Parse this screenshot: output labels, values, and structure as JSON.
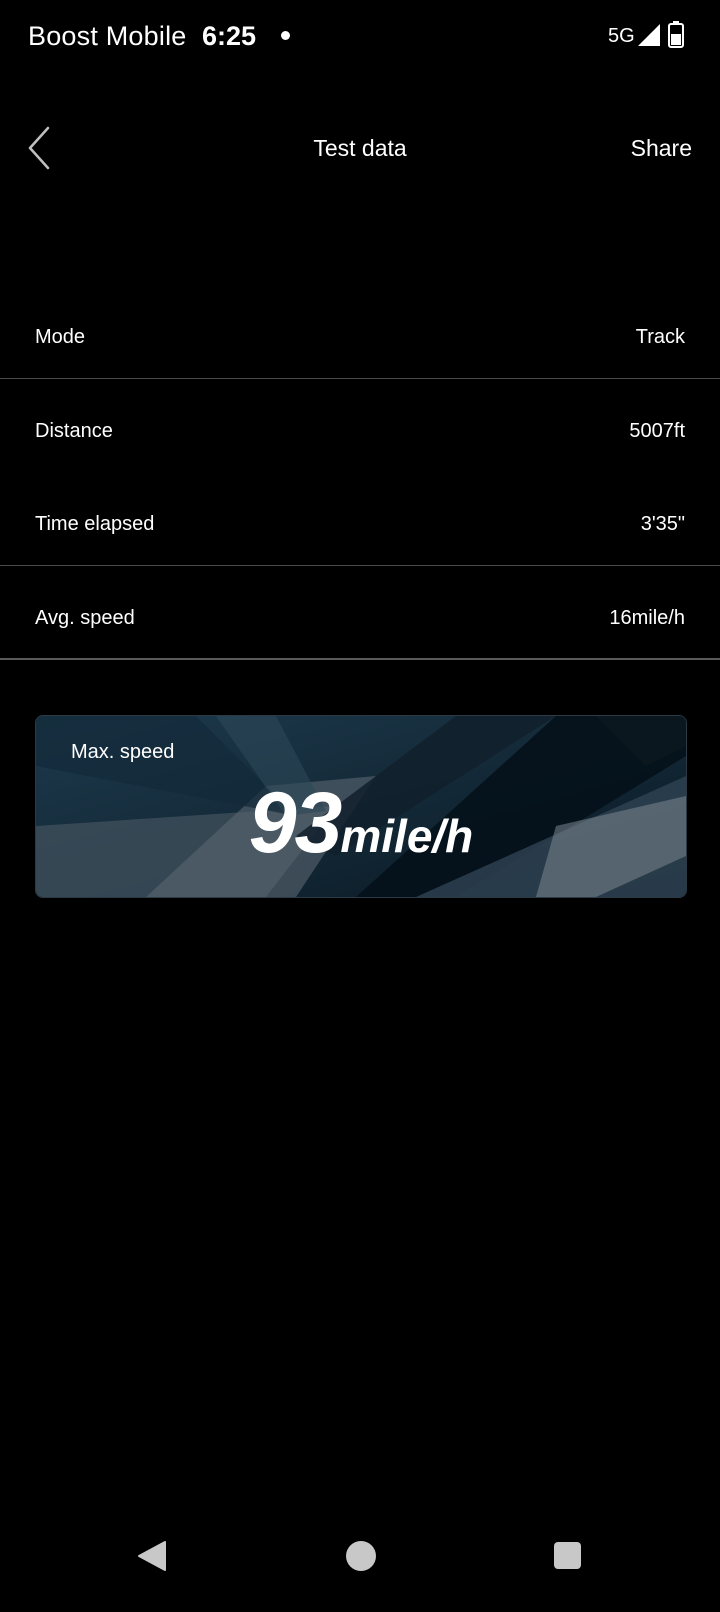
{
  "status_bar": {
    "carrier": "Boost Mobile",
    "time": "6:25",
    "network": "5G"
  },
  "header": {
    "title": "Test data",
    "share_label": "Share",
    "back_icon": "chevron-left-icon"
  },
  "rows": [
    {
      "label": "Mode",
      "value": "Track"
    },
    {
      "label": "Distance",
      "value": "5007ft"
    },
    {
      "label": "Time elapsed",
      "value": "3'35\""
    },
    {
      "label": "Avg. speed",
      "value": "16mile/h"
    }
  ],
  "max_speed": {
    "label": "Max. speed",
    "value": "93",
    "unit": "mile/h"
  },
  "nav_bar": {
    "back_icon": "triangle-back-icon",
    "home_icon": "circle-home-icon",
    "recents_icon": "square-recents-icon"
  },
  "colors": {
    "background": "#000000",
    "text": "#ffffff",
    "divider": "#4a4a4a",
    "card_base": "#0d1b26"
  }
}
